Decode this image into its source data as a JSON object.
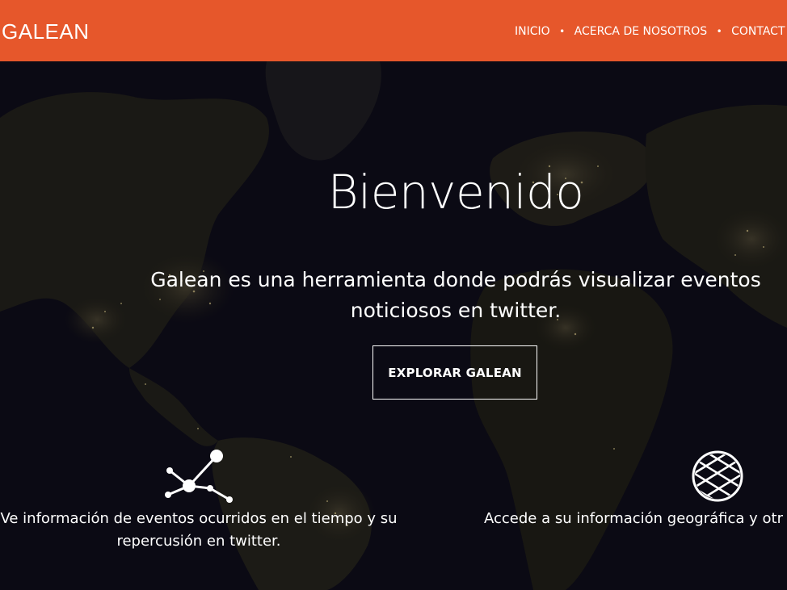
{
  "header": {
    "brand": "GALEAN",
    "background_color": "#e6572b",
    "nav": {
      "items": [
        {
          "label": "INICIO"
        },
        {
          "label": "ACERCA DE NOSOTROS"
        },
        {
          "label": "CONTACT"
        }
      ],
      "separator": "•"
    }
  },
  "hero": {
    "background": "world-map-night-lights",
    "title": "Bienvenido",
    "subtitle_line1": "Galean es una herramienta donde podrás visualizar eventos",
    "subtitle_line2": "noticiosos en twitter.",
    "cta_label": "EXPLORAR GALEAN"
  },
  "features": [
    {
      "icon": "network-graph-icon",
      "line1": "Ve información de eventos ocurridos en el tiempo y su",
      "line2": "repercusión en twitter."
    },
    {
      "icon": "globe-icon",
      "line1": "Accede a su información geográfica y otr",
      "line2": ""
    }
  ]
}
